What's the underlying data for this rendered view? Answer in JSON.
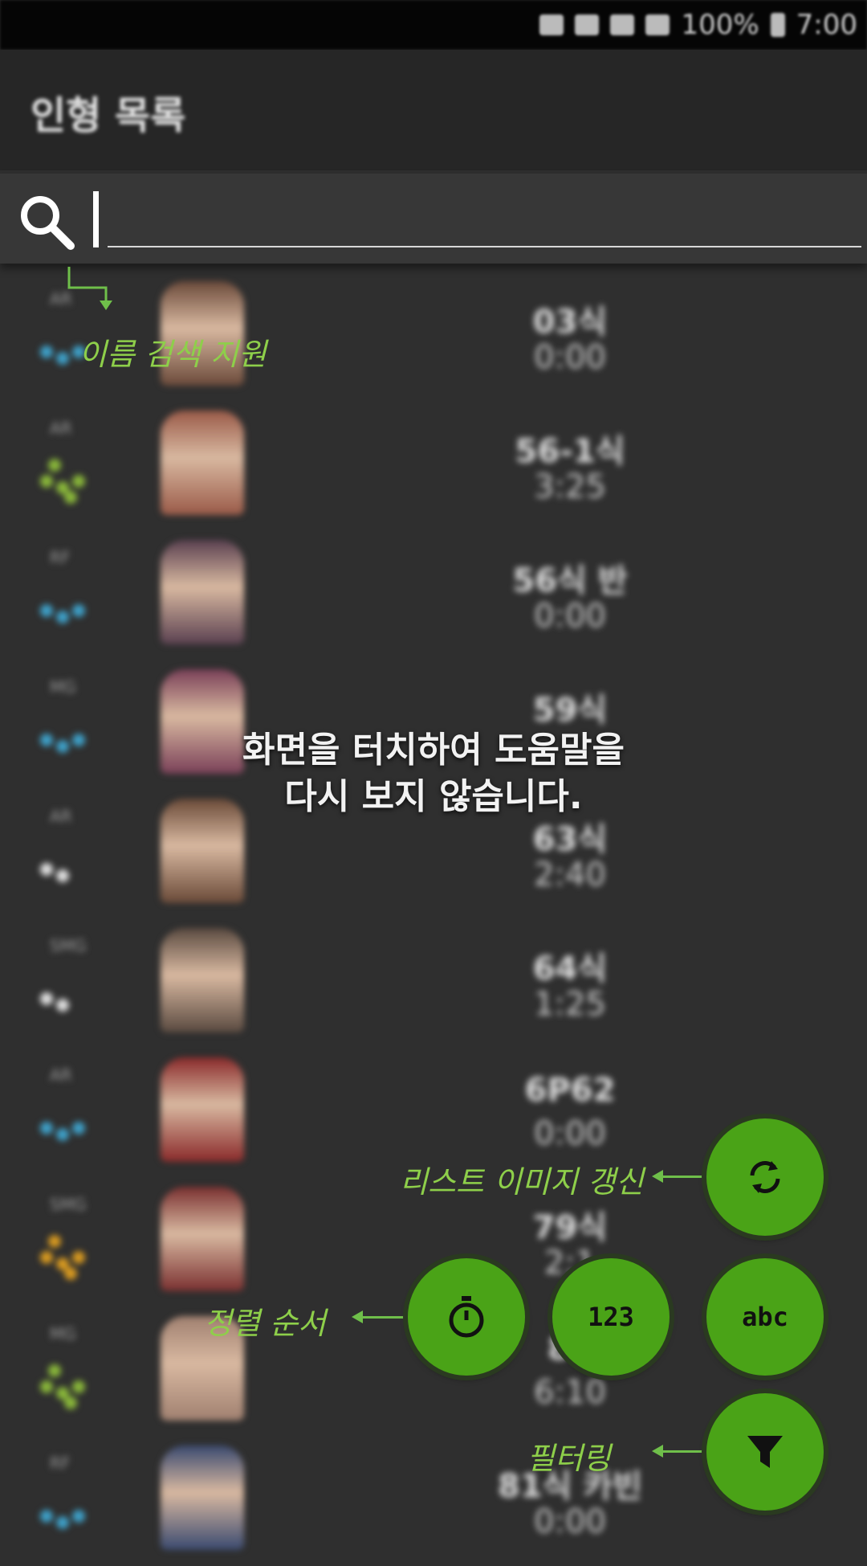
{
  "status_bar": {
    "battery": "100%",
    "time": "7:00"
  },
  "app_bar": {
    "title": "인형 목록"
  },
  "search": {
    "value": "",
    "placeholder": ""
  },
  "rows": [
    {
      "type": "AR",
      "time1": "03식",
      "time2": "0:00",
      "stars": 3,
      "star_color": "#3ea0c8",
      "portrait_color": "#6b4a3a"
    },
    {
      "type": "AR",
      "time1": "56-1식",
      "time2": "3:25",
      "stars": 5,
      "star_color": "#8ab83a",
      "portrait_color": "#9a5a48"
    },
    {
      "type": "RF",
      "time1": "56식 반",
      "time2": "0:00",
      "stars": 3,
      "star_color": "#3ea0c8",
      "portrait_color": "#5a4050"
    },
    {
      "type": "MG",
      "time1": "59식",
      "time2": "",
      "stars": 3,
      "star_color": "#3ea0c8",
      "portrait_color": "#7a4058"
    },
    {
      "type": "AR",
      "time1": "63식",
      "time2": "2:40",
      "stars": 2,
      "star_color": "#e0e0e0",
      "portrait_color": "#6a4a38"
    },
    {
      "type": "SMG",
      "time1": "64식",
      "time2": "1:25",
      "stars": 2,
      "star_color": "#e0e0e0",
      "portrait_color": "#5a4a40"
    },
    {
      "type": "AR",
      "time1": "6P62",
      "time2": "0:00",
      "stars": 3,
      "star_color": "#3ea0c8",
      "portrait_color": "#8a2a2a"
    },
    {
      "type": "SMG",
      "time1": "79식",
      "time2": "2:1",
      "stars": 5,
      "star_color": "#d89a20",
      "portrait_color": "#7a3030"
    },
    {
      "type": "MG",
      "time1": "80",
      "time2": "6:10",
      "stars": 5,
      "star_color": "#8ab83a",
      "portrait_color": "#a08070"
    },
    {
      "type": "RF",
      "time1": "81식 카빈",
      "time2": "0:00",
      "stars": 3,
      "star_color": "#3ea0c8",
      "portrait_color": "#3a4a70"
    }
  ],
  "overlay": {
    "line1": "화면을 터치하여 도움말을",
    "line2": "다시 보지 않습니다."
  },
  "hints": {
    "search": "이름 검색 지원",
    "refresh": "리스트 이미지 갱신",
    "sort": "정렬 순서",
    "filter": "필터링"
  },
  "fab": {
    "numeric_label": "123",
    "alpha_label": "abc"
  },
  "colors": {
    "fab": "#4aa317",
    "hint": "#8ecf4a"
  }
}
